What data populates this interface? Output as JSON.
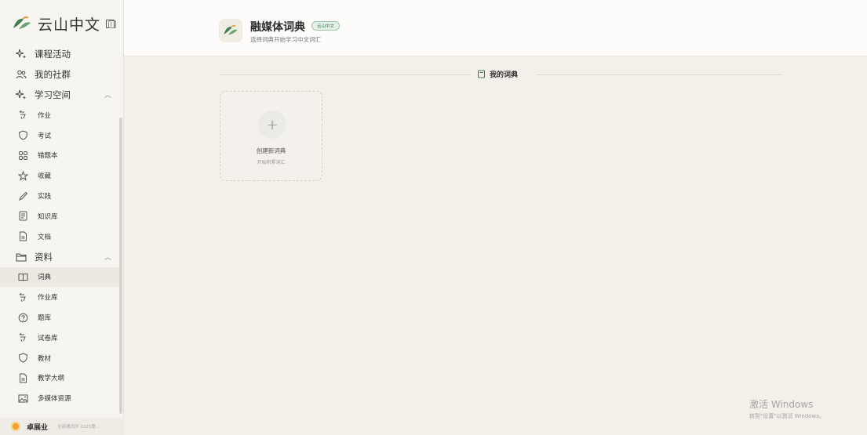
{
  "brand": {
    "name": "云山中文"
  },
  "nav": {
    "top": [
      {
        "label": "课程活动",
        "icon": "sparkle-icon"
      },
      {
        "label": "我的社群",
        "icon": "users-icon"
      },
      {
        "label": "学习空间",
        "icon": "sparkle-icon",
        "expanded": true
      }
    ],
    "learning": [
      {
        "label": "作业",
        "icon": "assignment-icon"
      },
      {
        "label": "考试",
        "icon": "shield-icon"
      },
      {
        "label": "错题本",
        "icon": "grid-icon"
      },
      {
        "label": "收藏",
        "icon": "star-icon"
      },
      {
        "label": "实践",
        "icon": "pen-icon"
      },
      {
        "label": "知识库",
        "icon": "knowledge-icon"
      },
      {
        "label": "文档",
        "icon": "document-icon"
      }
    ],
    "resources": {
      "label": "资料",
      "icon": "folder-icon",
      "expanded": true
    },
    "resource_items": [
      {
        "label": "词典",
        "icon": "book-open-icon",
        "active": true
      },
      {
        "label": "作业库",
        "icon": "assignment-icon"
      },
      {
        "label": "题库",
        "icon": "question-icon"
      },
      {
        "label": "试卷库",
        "icon": "assignment-icon"
      },
      {
        "label": "教材",
        "icon": "shield-icon"
      },
      {
        "label": "教学大纲",
        "icon": "document-icon"
      },
      {
        "label": "多媒体资源",
        "icon": "image-icon"
      }
    ]
  },
  "user": {
    "name": "卓展业",
    "copyright": "全部通讯所 2025理..."
  },
  "header": {
    "title": "融媒体词典",
    "tag": "云山中文",
    "subtitle": "选择词典开始学习中文词汇"
  },
  "main": {
    "section_title": "我的词典",
    "create_card": {
      "title": "创建新词典",
      "subtitle": "开始积累词汇",
      "plus": "+"
    }
  },
  "watermark": {
    "title": "激活 Windows",
    "subtitle": "转到\"设置\"以激活 Windows。"
  },
  "colors": {
    "accent": "#3a7a4d",
    "background": "#f3efe9",
    "sidebar": "#f7f5f1"
  }
}
